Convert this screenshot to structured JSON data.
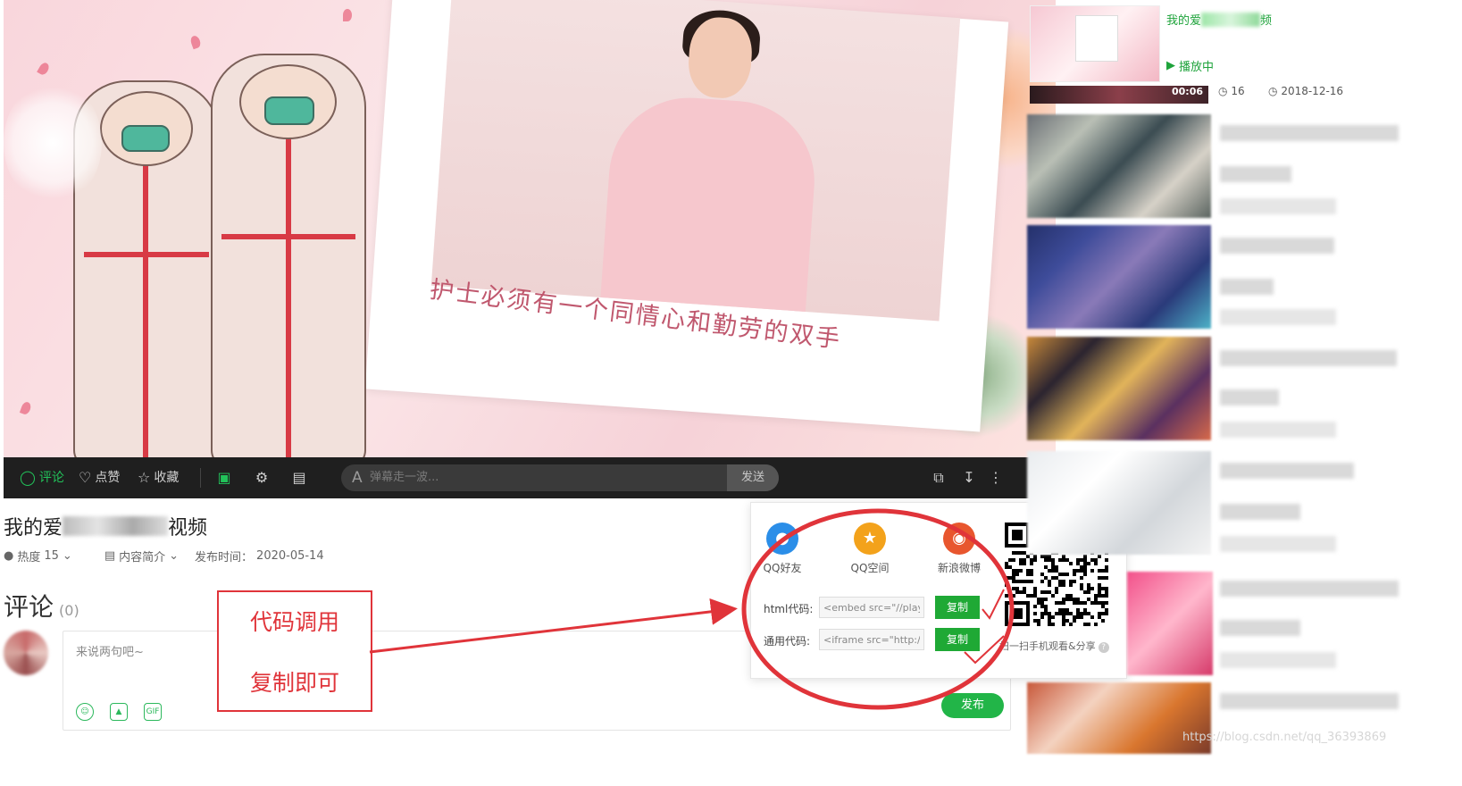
{
  "video": {
    "caption": "护士必须有一个同情心和勤劳的双手"
  },
  "controls": {
    "comment": "评论",
    "like": "点赞",
    "favorite": "收藏",
    "danmu_toggle_icon": "danmu-toggle-icon",
    "danmu_settings_icon": "danmu-settings-icon",
    "danmu_list_icon": "danmu-list-icon",
    "danmu_prefix": "A",
    "danmu_placeholder": "弹幕走一波...",
    "send": "发送",
    "share_icon": "share-icon",
    "download_icon": "download-icon",
    "more_icon": "more-icon"
  },
  "info": {
    "title_left": "我的爱",
    "title_right": "视频",
    "heat_label": "热度",
    "heat_value": "15",
    "intro_label": "内容简介",
    "publish_label": "发布时间：",
    "publish_date": "2020-05-14"
  },
  "comments": {
    "heading": "评论",
    "count": "(0)",
    "placeholder": "来说两句吧~",
    "gif_label": "GIF",
    "post": "发布"
  },
  "annotation": {
    "line1": "代码调用",
    "line2": "复制即可",
    "color": "#e0343a"
  },
  "share": {
    "options": [
      {
        "label": "QQ好友",
        "color": "#2b8ee8"
      },
      {
        "label": "QQ空间",
        "color": "#f3a21b"
      },
      {
        "label": "新浪微博",
        "color": "#e8562e"
      }
    ],
    "html_label": "html代码:",
    "html_value": "<embed src=\"//player.",
    "general_label": "通用代码:",
    "general_value": "<iframe src=\"http://op",
    "copy": "复制",
    "qr_tip": "扫一扫手机观看&分享",
    "help": "?"
  },
  "sidebar": {
    "now_title_left": "我的爱",
    "now_title_right": "频",
    "playing": "播放中",
    "duration": "00:06",
    "views": "16",
    "date": "2018-12-16"
  },
  "watermark": "https://blog.csdn.net/qq_36393869",
  "colors": {
    "accent_green": "#22b548",
    "control_bar": "#1f1f1f",
    "annotation_red": "#e0343a"
  }
}
